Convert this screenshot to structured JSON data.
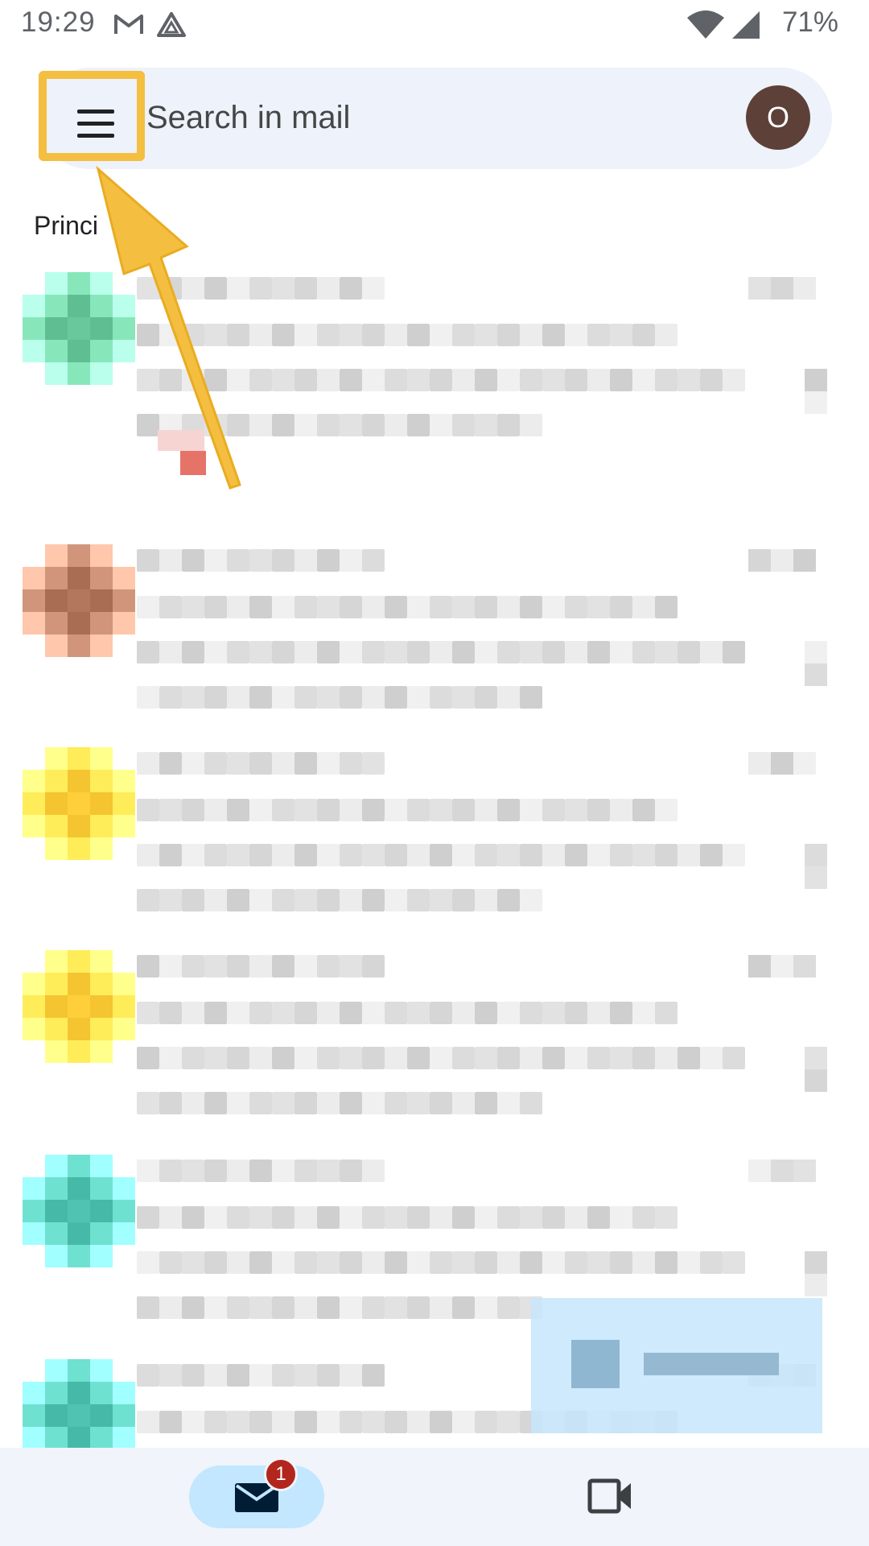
{
  "status_bar": {
    "time": "19:29",
    "battery": "71%",
    "icons": [
      "gmail-icon",
      "drive-icon",
      "wifi-icon",
      "signal-icon"
    ]
  },
  "search": {
    "placeholder": "Search in mail",
    "avatar_letter": "O",
    "avatar_color": "#5d4037"
  },
  "menu": {
    "icon": "hamburger-menu-icon",
    "highlight_color": "#f4bf40"
  },
  "section": {
    "label": "Princi"
  },
  "email_rows": [
    {
      "avatar_color": "#5fbf92"
    },
    {
      "avatar_color": "#a86d52"
    },
    {
      "avatar_color": "#f5c431"
    },
    {
      "avatar_color": "#f5c431"
    },
    {
      "avatar_color": "#47b9a8"
    },
    {
      "avatar_color": "#47b9a8"
    }
  ],
  "bottom_nav": {
    "mail_badge": "1",
    "mail_icon": "mail-icon",
    "meet_icon": "video-camera-icon",
    "active_color": "#c2e7ff"
  }
}
